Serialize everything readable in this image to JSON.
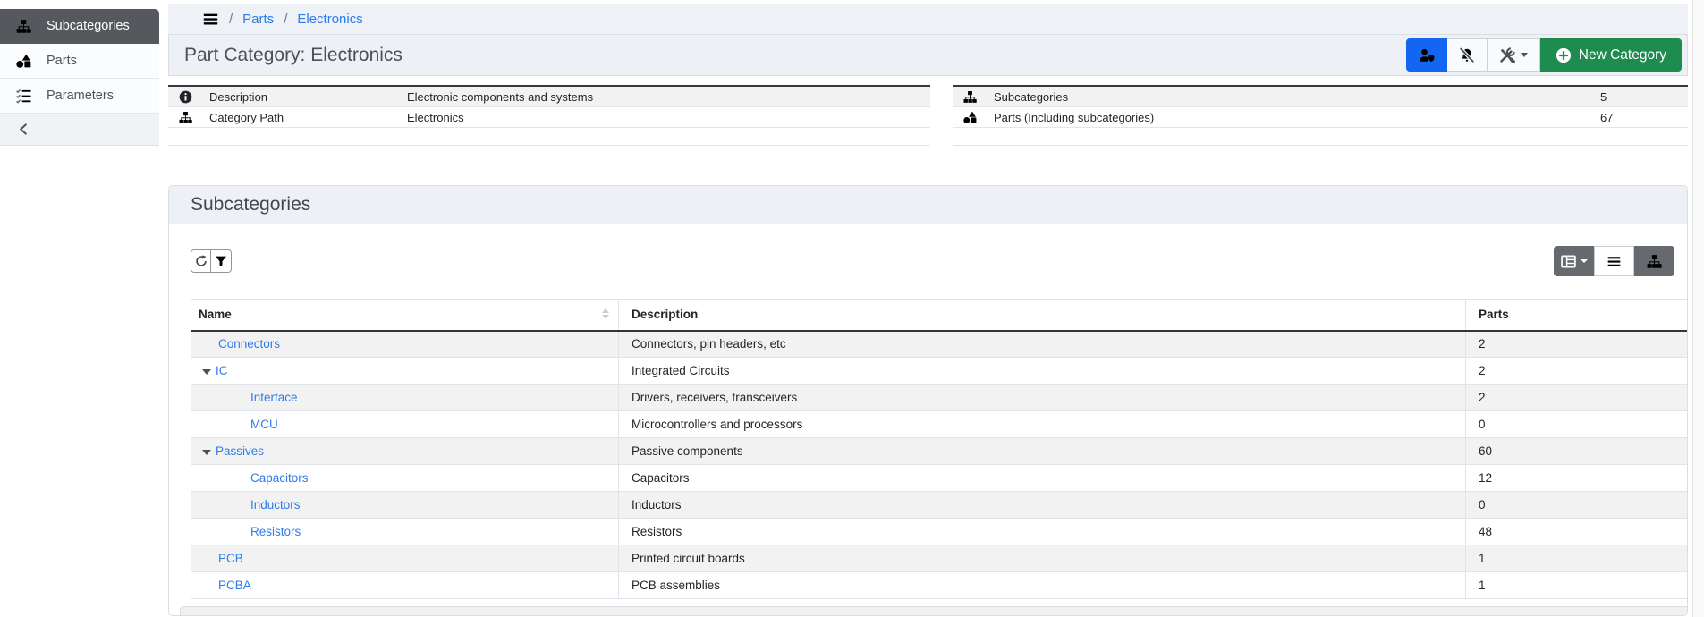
{
  "colors": {
    "accent_blue": "#1266f1",
    "link_blue": "#2e7bea",
    "success_green": "#1e8c4e",
    "dark_button_gray": "#66696e",
    "active_sidebar_gray": "#55595e"
  },
  "sidebar": {
    "items": [
      {
        "label": "Subcategories",
        "icon": "sitemap-icon",
        "active": true
      },
      {
        "label": "Parts",
        "icon": "shapes-icon",
        "active": false
      },
      {
        "label": "Parameters",
        "icon": "list-check-icon",
        "active": false
      }
    ],
    "collapse_icon": "chevron-left-icon"
  },
  "breadcrumb": {
    "menu_icon": "hamburger-icon",
    "separator": "/",
    "items": [
      {
        "label": "Parts"
      },
      {
        "label": "Electronics"
      }
    ]
  },
  "header": {
    "title": "Part Category: Electronics",
    "actions": [
      {
        "name": "user-permissions",
        "icon": "user-shield-icon",
        "style": "primary"
      },
      {
        "name": "notifications-off",
        "icon": "bell-slash-icon",
        "style": "light"
      },
      {
        "name": "tools-menu",
        "icon": "tools-icon",
        "style": "light",
        "has_caret": true
      },
      {
        "name": "new-category",
        "icon": "plus-circle-icon",
        "label": "New Category",
        "style": "success"
      }
    ]
  },
  "details": {
    "left": {
      "rows": [
        {
          "icon": "info-circle-icon",
          "label": "Description",
          "value": "Electronic components and systems"
        },
        {
          "icon": "sitemap-icon",
          "label": "Category Path",
          "value": "Electronics"
        }
      ]
    },
    "right": {
      "rows": [
        {
          "icon": "sitemap-icon",
          "label": "Subcategories",
          "value": "5"
        },
        {
          "icon": "shapes-icon",
          "label": "Parts (Including subcategories)",
          "value": "67"
        }
      ]
    }
  },
  "section": {
    "title": "Subcategories",
    "toolbar": {
      "left_icons": [
        "refresh-icon",
        "filter-icon"
      ],
      "right_icons": [
        "table-icon",
        "list-icon",
        "sitemap-icon"
      ],
      "active_view": "list"
    }
  },
  "table": {
    "columns": [
      {
        "label": "Name",
        "sortable": true
      },
      {
        "label": "Description",
        "sortable": false
      },
      {
        "label": "Parts",
        "sortable": false
      }
    ],
    "rows": [
      {
        "name": "Connectors",
        "description": "Connectors, pin headers, etc",
        "parts": "2",
        "depth": 1,
        "expandable": false
      },
      {
        "name": "IC",
        "description": "Integrated Circuits",
        "parts": "2",
        "depth": 1,
        "expandable": true,
        "expanded": true
      },
      {
        "name": "Interface",
        "description": "Drivers, receivers, transceivers",
        "parts": "2",
        "depth": 2,
        "expandable": false
      },
      {
        "name": "MCU",
        "description": "Microcontrollers and processors",
        "parts": "0",
        "depth": 2,
        "expandable": false
      },
      {
        "name": "Passives",
        "description": "Passive components",
        "parts": "60",
        "depth": 1,
        "expandable": true,
        "expanded": true
      },
      {
        "name": "Capacitors",
        "description": "Capacitors",
        "parts": "12",
        "depth": 2,
        "expandable": false
      },
      {
        "name": "Inductors",
        "description": "Inductors",
        "parts": "0",
        "depth": 2,
        "expandable": false
      },
      {
        "name": "Resistors",
        "description": "Resistors",
        "parts": "48",
        "depth": 2,
        "expandable": false
      },
      {
        "name": "PCB",
        "description": "Printed circuit boards",
        "parts": "1",
        "depth": 1,
        "expandable": false
      },
      {
        "name": "PCBA",
        "description": "PCB assemblies",
        "parts": "1",
        "depth": 1,
        "expandable": false
      }
    ]
  }
}
